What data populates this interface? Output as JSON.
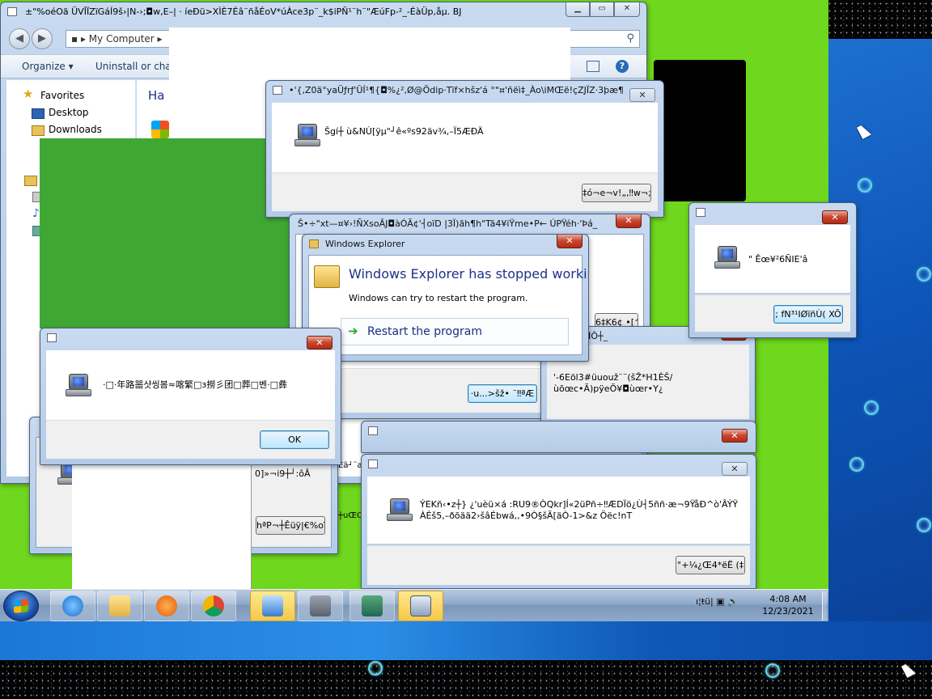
{
  "explorer": {
    "title": "±\"%oéOã ÜVÎÏZïGáÍ9š›|N-›;◘w,E–| ·    íeÐü>XÌÈ7Éâ¨ñåÉoV*úÀce3p¨_k$iPÑ¹¨h¨\"ÆúFp-²_-ÉàÜp,åµ. BJ",
    "address": "My Computer",
    "commands": {
      "organize": "Organize ▾",
      "uninstall": "Uninstall or chang"
    },
    "nav": {
      "favorites": "Favorites",
      "desktop": "Desktop",
      "downloads": "Downloads"
    },
    "content_heading": "Ha"
  },
  "dialog_top": {
    "title": "•'{,Z0ä°yaÜƒrƒ'ÛÍ¹¶{◘%¿²,Ø@Ödip·Tïf×hšz'á °\"¤'ñëì‡_Ào\\iMŒë!çZJÏZ·3þæ¶$\\...",
    "message": "Šgí┼ ù&NÙ[ÿµ\"┘ê«ºs92äv¾,–Ï5ÆÐÄ",
    "button": "‡ó¬e¬v!„,‼w¬;á("
  },
  "dialog_mid": {
    "title": "Š•÷\"xt—¤¥›!ÑXsoÂJ◘àÓÃ¢'┤oïD |3Ï)ãh¶h\"Tã4¥iŸme•P← ÚPŸéh·'Þá_",
    "button": "·u...>šž•  ¨‼ªÆ",
    "button2": "6‡K6¢ •[^]"
  },
  "dialog_right": {
    "message": "\"   Êœ¥²6ÑIE'â",
    "button": "; fN³¹IØïñÙ(  XÕ"
  },
  "stopped": {
    "title": "Windows Explorer",
    "heading": "Windows Explorer has stopped working",
    "body": "Windows can try to restart the program.",
    "restart": "Restart the program"
  },
  "dialog_cjk": {
    "message": "·□·年路噐샷씽봄≈喀繁□з撈彡团□葬□벤·□彝",
    "ok": "OK"
  },
  "dialog_back": {
    "partial_title": "¬ÿ:QóO◘Ô┼_",
    "line1": "'-6Eöl3#üuouž¨¨(šŽ*H1ÈŠ∕",
    "line2": "ùõœc•Ã)pÿeÕ¥◘ùœr•Y¿",
    "partial_a": "0]»¬i9┼┘:ôÂ",
    "partial_b": "┼uŒÕ",
    "partial_c": "Eä┘¨a",
    "button_small": "hªP¬┼Êüÿ|€%oïi"
  },
  "dialog_bottom": {
    "line1": "ÝEKñ‹•z┼}    ¿'uèü×á :RU9®ÒQkr]Í«2üPñ÷‼ÆDÏö¿Ù┤5ññ·æ¬9ŸåÐ^ò'ÂÝŸ",
    "line2": "ÀÉš5,–ðõää2›šâÉbwá,,•9Ò§šÃ[äÒ-1>&z    Öëc!nT",
    "button": "°+¼¿Œ4*ëË   (‡"
  },
  "taskbar": {
    "time": "4:08 AM",
    "date": "12/23/2021",
    "tray": "ı¦ŧü|"
  }
}
